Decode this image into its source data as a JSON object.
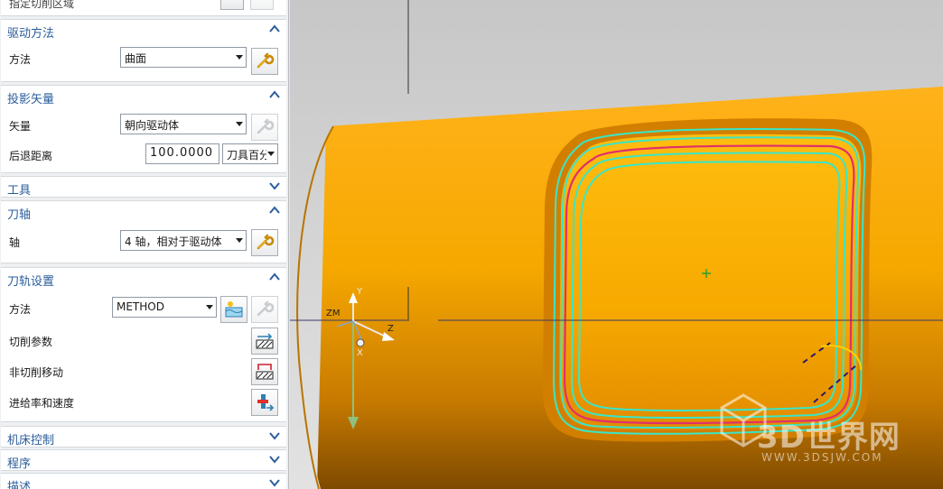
{
  "panel": {
    "top_partial_label": "指定切削区域",
    "drive_method": {
      "title": "驱动方法",
      "method_label": "方法",
      "method_value": "曲面"
    },
    "projection_vector": {
      "title": "投影矢量",
      "vector_label": "矢量",
      "vector_value": "朝向驱动体",
      "retract_label": "后退距离",
      "retract_value": "100.0000",
      "retract_unit": "刀具百分比"
    },
    "tool": {
      "title": "工具"
    },
    "tool_axis": {
      "title": "刀轴",
      "axis_label": "轴",
      "axis_value": "4 轴，相对于驱动体"
    },
    "path_settings": {
      "title": "刀轨设置",
      "method_label": "方法",
      "method_value": "METHOD",
      "cut_params_label": "切削参数",
      "non_cut_label": "非切削移动",
      "feeds_label": "进给率和速度"
    },
    "machine_control": {
      "title": "机床控制"
    },
    "program": {
      "title": "程序"
    },
    "description": {
      "title": "描述"
    }
  },
  "viewport": {
    "triad": {
      "zm": "ZM",
      "y": "Y",
      "z": "Z",
      "x": "X"
    },
    "watermark": {
      "brand": "3D世界网",
      "url": "WWW.3DSJW.COM"
    },
    "colors": {
      "cylinder": "#f6a800",
      "toolpath_cyan": "#39e6c8",
      "toolpath_magenta": "#e0306a",
      "background": "#cfcfcf",
      "panel_title": "#2b5d9b"
    }
  }
}
